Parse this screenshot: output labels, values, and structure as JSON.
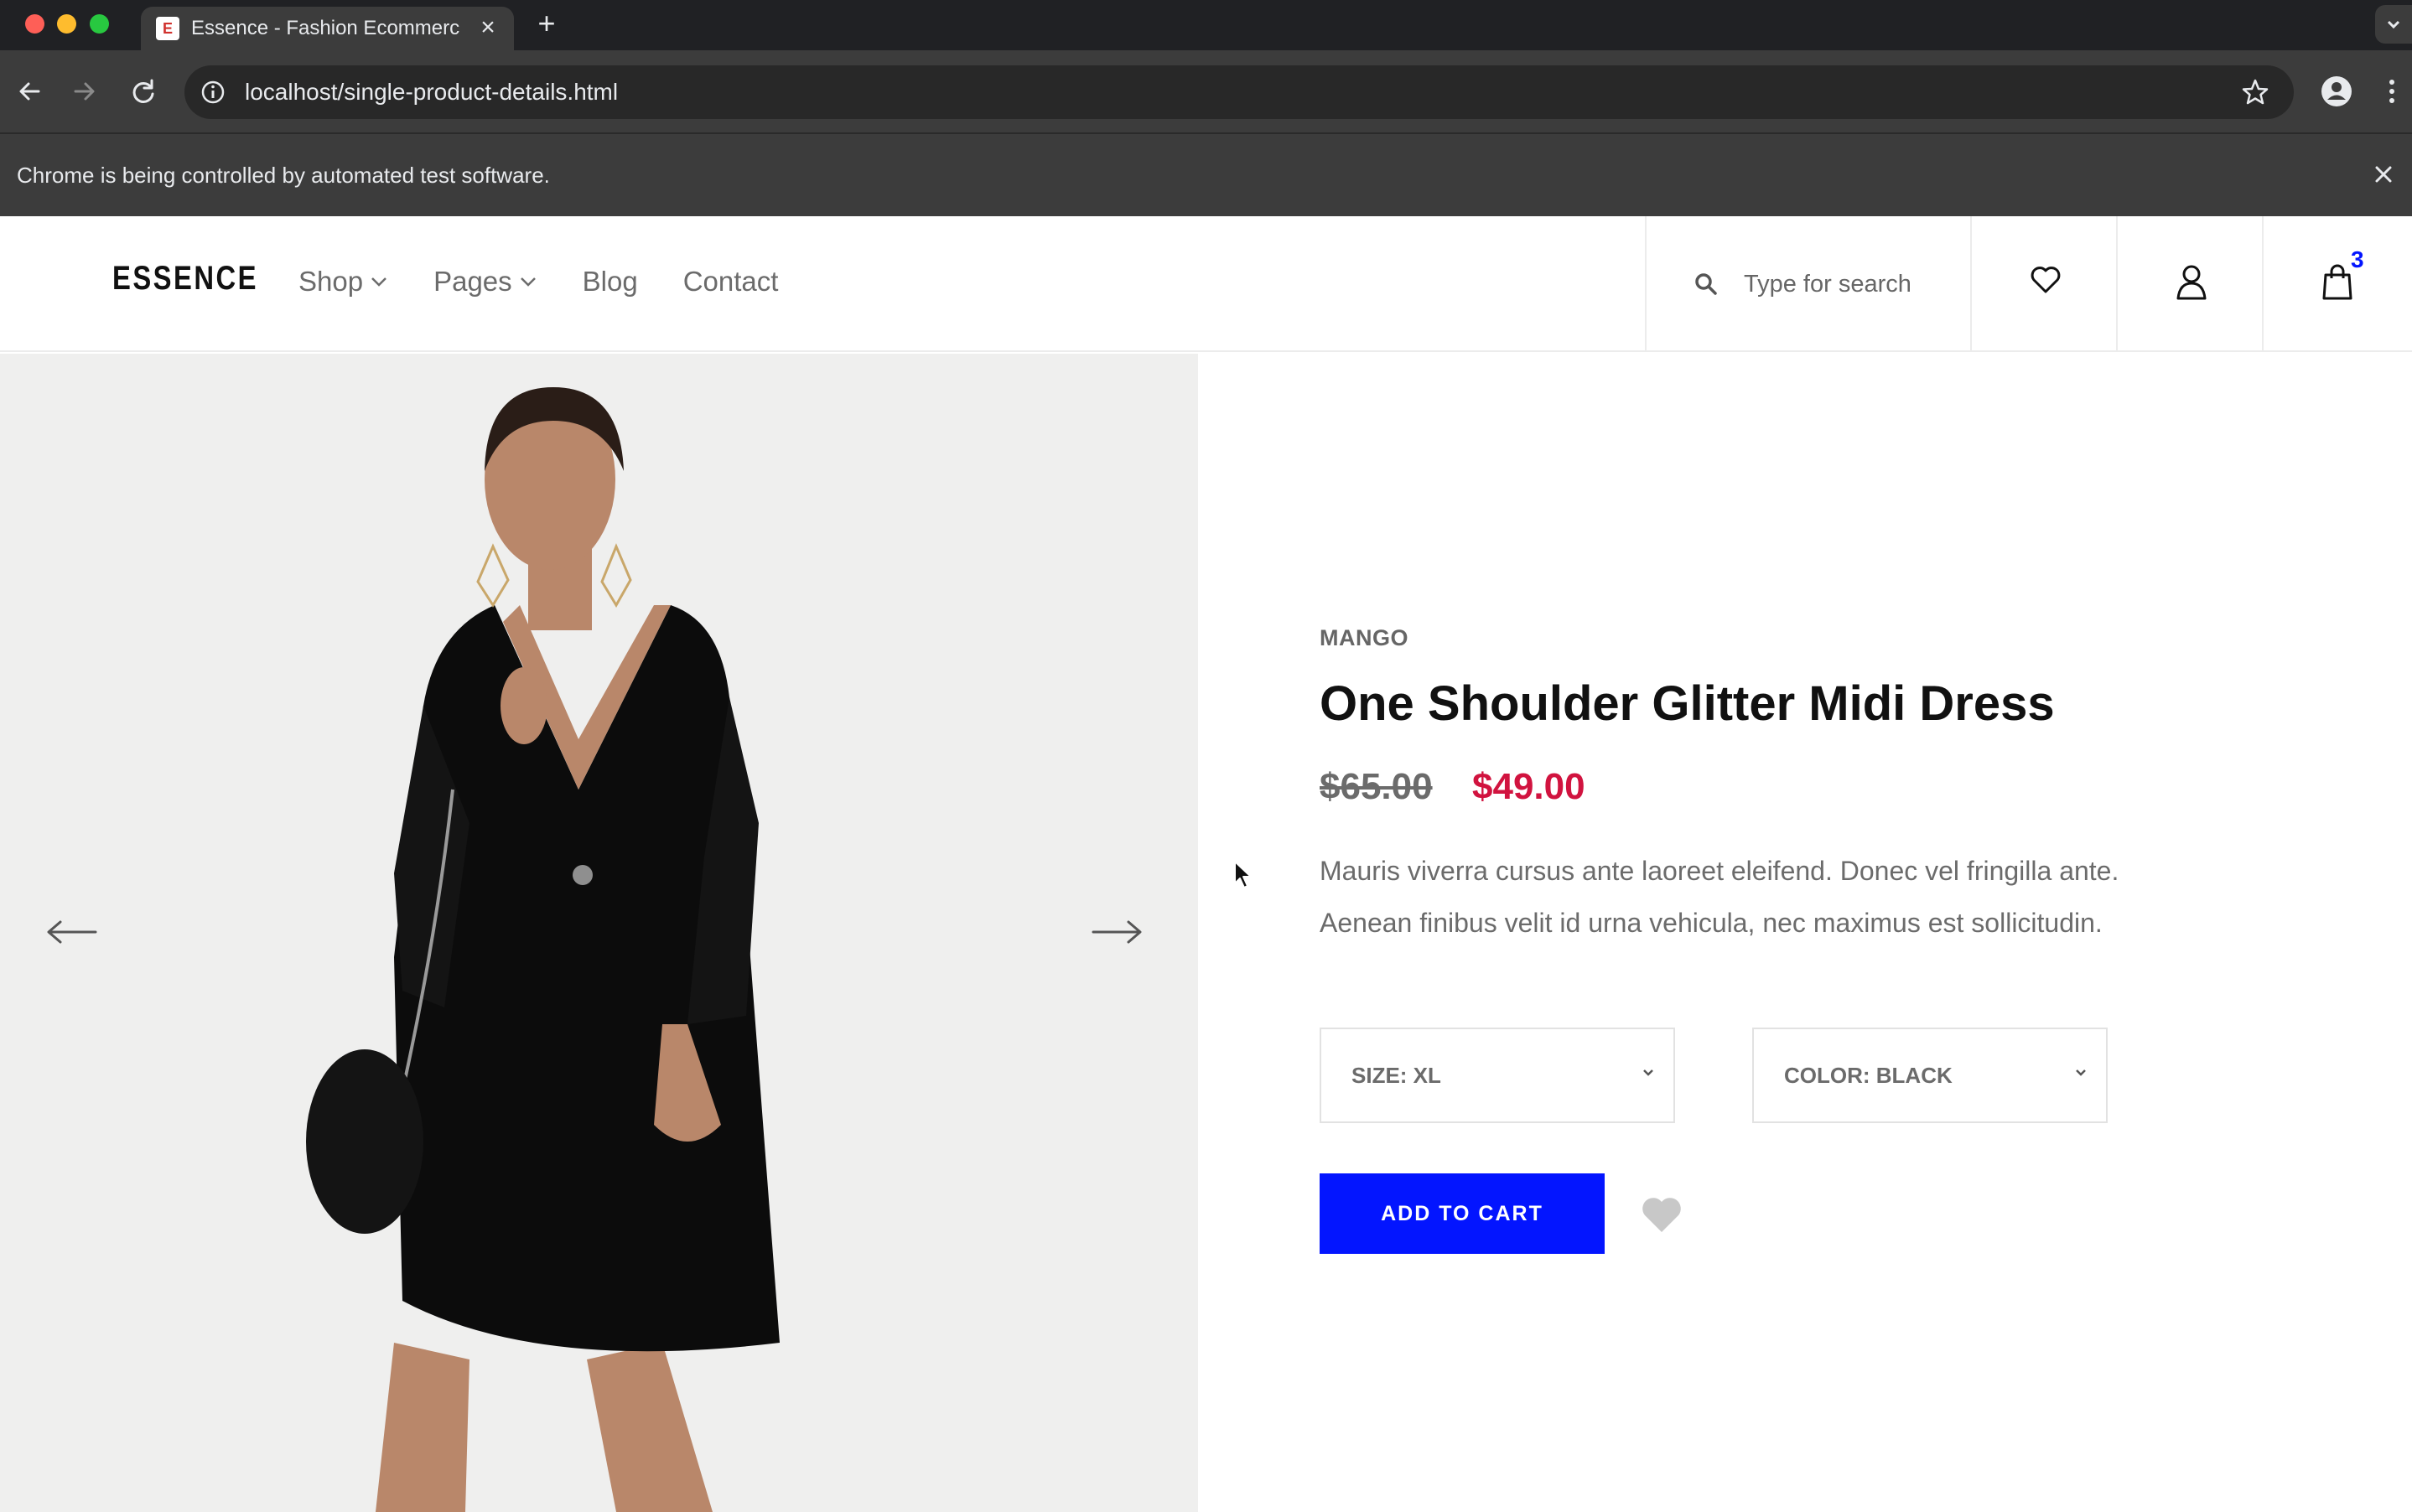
{
  "browser": {
    "tab_favicon_letter": "E",
    "tab_title": "Essence - Fashion Ecommerce",
    "url": "localhost/single-product-details.html",
    "automation_notice": "Chrome is being controlled by automated test software."
  },
  "header": {
    "logo": "ESSENCE",
    "nav": [
      {
        "label": "Shop",
        "has_dropdown": true
      },
      {
        "label": "Pages",
        "has_dropdown": true
      },
      {
        "label": "Blog",
        "has_dropdown": false
      },
      {
        "label": "Contact",
        "has_dropdown": false
      }
    ],
    "search_placeholder": "Type for search",
    "cart_count": "3",
    "icons": [
      "search-icon",
      "heart-icon",
      "user-icon",
      "shopping-bag-icon"
    ]
  },
  "gallery": {
    "image_description": "product-photo-black-dress",
    "prev_icon": "arrow-left-icon",
    "next_icon": "arrow-right-icon"
  },
  "product": {
    "brand": "MANGO",
    "title": "One Shoulder Glitter Midi Dress",
    "old_price": "$65.00",
    "new_price": "$49.00",
    "description_line1": "Mauris viverra cursus ante laoreet eleifend. Donec vel fringilla ante.",
    "description_line2": "Aenean finibus velit id urna vehicula, nec maximus est sollicitudin.",
    "size_select": "SIZE: XL",
    "color_select": "COLOR: BLACK",
    "add_to_cart": "ADD TO CART"
  },
  "colors": {
    "accent": "#0315ff",
    "sale_price": "#d1133f",
    "chrome_bg": "#3c3c3c"
  }
}
